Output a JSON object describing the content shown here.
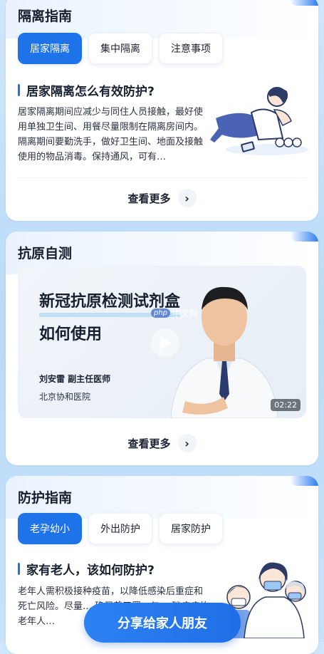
{
  "isolation": {
    "title": "隔离指南",
    "tabs": [
      "居家隔离",
      "集中隔离",
      "注意事项"
    ],
    "active_tab": 0,
    "article_title": "居家隔离怎么有效防护?",
    "article_text": "居家隔离期间应减少与同住人员接触，最好使用单独卫生间、用餐尽量限制在隔离房间内。隔离期间要勤洗手，做好卫生间、地面及接触使用的物品消毒。保持通风，可有…",
    "more_label": "查看更多"
  },
  "antigen": {
    "title": "抗原自测",
    "video_title_line1": "新冠抗原检测试剂盒",
    "video_title_line2": "如何使用",
    "doctor": "刘安雷  副主任医师",
    "hospital": "北京协和医院",
    "duration": "02:22",
    "watermark_logo": "php",
    "watermark_text": "中文网",
    "more_label": "查看更多"
  },
  "protection": {
    "title": "防护指南",
    "tabs": [
      "老孕幼小",
      "外出防护",
      "居家防护"
    ],
    "active_tab": 0,
    "article_title": "家有老人，该如何防护?",
    "article_text_visible": "老年人需积极接种疫苗，以降低感染后重症和死亡风险。尽量… 确佩戴口罩，与… 础疾病的老年人…"
  },
  "share_button": "分享给家人朋友",
  "colors": {
    "accent": "#1f73e8",
    "background": "#c4e0fa"
  }
}
